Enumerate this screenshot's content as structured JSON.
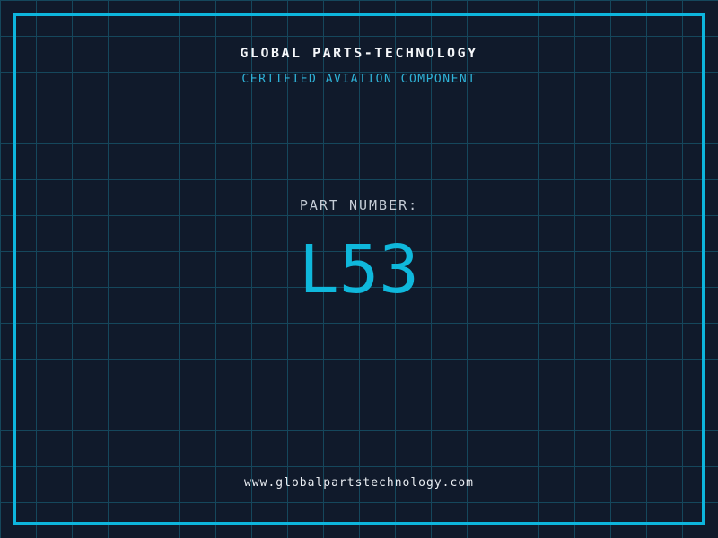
{
  "theme": {
    "background": "#101a2b",
    "grid_line": "#15475c",
    "border_color": "#0db5dd",
    "title_color": "#f5f7fa",
    "subtitle_color": "#2fb3d8",
    "label_color": "#c5ccd6",
    "part_color": "#0fb8dc",
    "url_color": "#e9edf2"
  },
  "header": {
    "title": "GLOBAL PARTS-TECHNOLOGY",
    "subtitle": "CERTIFIED AVIATION COMPONENT"
  },
  "part": {
    "label": "PART NUMBER:",
    "number": "L53"
  },
  "footer": {
    "url": "www.globalpartstechnology.com"
  }
}
